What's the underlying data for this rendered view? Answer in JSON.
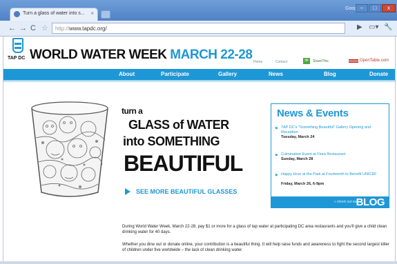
{
  "browser": {
    "tab_title": "Turn a glass of water into s...",
    "tab_close": "×",
    "user": "Google",
    "url_protocol": "http://",
    "url_host": "www.tapdc.org/",
    "icons": {
      "back": "←",
      "forward": "→",
      "reload": "C",
      "star": "☆",
      "go": "▶",
      "page": "▭▾",
      "wrench": "🔧",
      "minimize": "–",
      "maximize": "□",
      "close": "x"
    }
  },
  "site": {
    "logo_text": "TAP DC",
    "headline_main": "WORLD WATER WEEK",
    "headline_date": "MARCH 22-28",
    "top_links": {
      "home": "Home",
      "contact": "Contact",
      "sharethis": "ShareThis",
      "opentable": "OpenTable.com"
    },
    "nav": [
      "About",
      "Participate",
      "Gallery",
      "News",
      "Blog",
      "Donate"
    ],
    "colors": {
      "brand_blue": "#1e97d6",
      "opentable_red": "#c0392b",
      "share_green": "#4fa844"
    }
  },
  "hero": {
    "line1": "turn a",
    "line2": "GLASS of WATER",
    "line3": "into SOMETHING",
    "line4": "BEAUTIFUL",
    "see_more": "SEE MORE BEAUTIFUL GLASSES"
  },
  "news": {
    "title": "News & Events",
    "items": [
      {
        "title": "TAP DC's \"Something Beautiful\" Gallery Opening and Reception",
        "date": "Tuesday, March 24"
      },
      {
        "title": "Culmination Event at Flora Restaurant",
        "date": "Sunday, March 28"
      },
      {
        "title": "Happy Hour at the Park at Fourteenth to Benefit UNICEF",
        "date": "Friday, March 26, 6-9pm"
      }
    ],
    "blog_check": "» check out our",
    "blog_word": "BLOG"
  },
  "body": {
    "p1": "During World Water Week, March 22-28, pay $1 or more for a glass of tap water at participating DC area restaurants and you'll give a child clean drinking water for 40 days.",
    "p2": "Whether you dine out or donate online, your contribution is a beautiful thing. It will help raise funds and awareness to fight the second largest killer of children under five worldwide – the lack of clean drinking water."
  }
}
